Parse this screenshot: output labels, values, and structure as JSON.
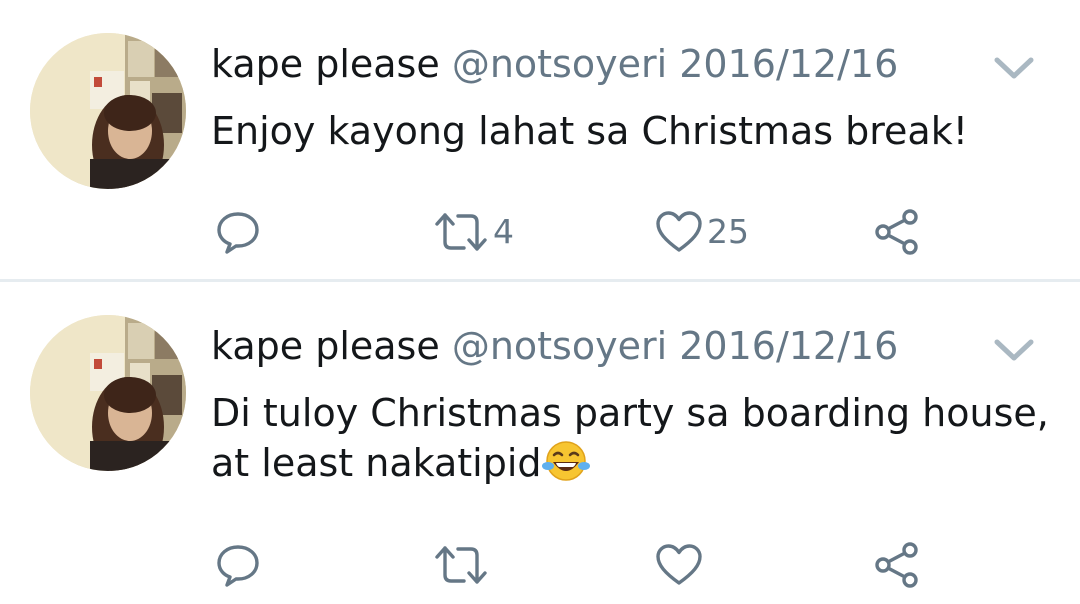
{
  "tweets": [
    {
      "name": "kape please",
      "handle": "@notsoyeri",
      "date": "2016/12/16",
      "text": "Enjoy kayong lahat sa Christmas break!",
      "retweet_count": "4",
      "like_count": "25"
    },
    {
      "name": "kape please",
      "handle": "@notsoyeri",
      "date": "2016/12/16",
      "text": "Di tuloy Christmas party sa boarding house, at least nakatipid",
      "emoji": "face-with-tears-of-joy",
      "retweet_count": "",
      "like_count": ""
    }
  ],
  "icons": {
    "reply": "reply-icon",
    "retweet": "retweet-icon",
    "like": "heart-icon",
    "share": "share-icon",
    "more": "chevron-down-icon"
  },
  "colors": {
    "text": "#14171a",
    "secondary": "#657786",
    "divider": "#e6ecf0",
    "emoji": "#f7c531"
  }
}
